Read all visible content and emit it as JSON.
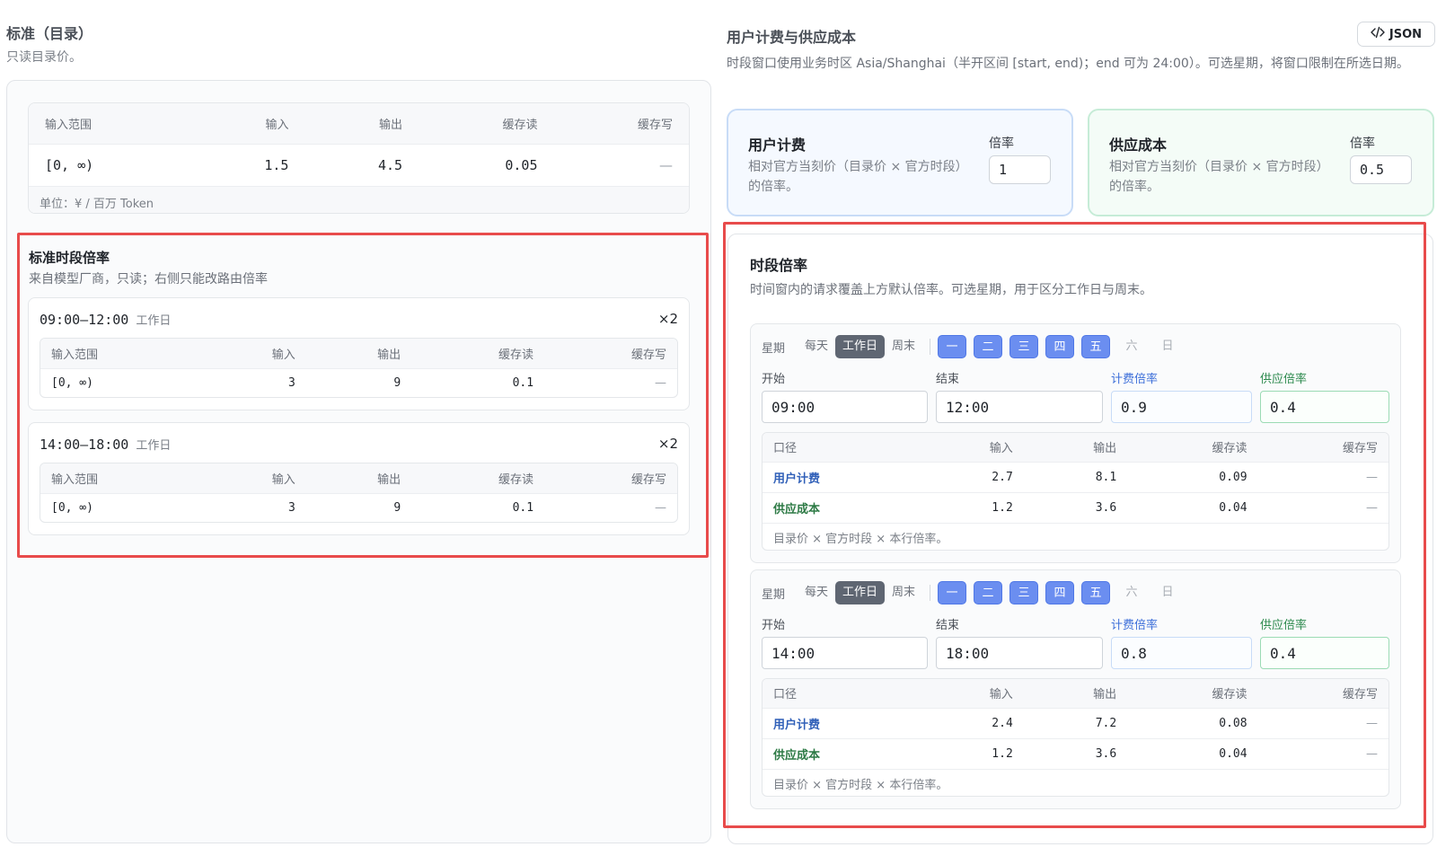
{
  "left": {
    "title": "标准（目录）",
    "subtitle": "只读目录价。",
    "base_table": {
      "headers": [
        "输入范围",
        "输入",
        "输出",
        "缓存读",
        "缓存写"
      ],
      "rows": [
        [
          "[0, ∞)",
          "1.5",
          "4.5",
          "0.05",
          "—"
        ]
      ],
      "unit": "单位：¥ / 百万 Token"
    },
    "std_period": {
      "title": "标准时段倍率",
      "subtitle": "来自模型厂商，只读；右侧只能改路由倍率",
      "slots": [
        {
          "time": "09:00–12:00",
          "tag": "工作日",
          "mult": "×2",
          "headers": [
            "输入范围",
            "输入",
            "输出",
            "缓存读",
            "缓存写"
          ],
          "row": [
            "[0, ∞)",
            "3",
            "9",
            "0.1",
            "—"
          ]
        },
        {
          "time": "14:00–18:00",
          "tag": "工作日",
          "mult": "×2",
          "headers": [
            "输入范围",
            "输入",
            "输出",
            "缓存读",
            "缓存写"
          ],
          "row": [
            "[0, ∞)",
            "3",
            "9",
            "0.1",
            "—"
          ]
        }
      ]
    }
  },
  "right": {
    "title": "用户计费与供应成本",
    "json_button": "JSON",
    "description": "时段窗口使用业务时区 Asia/Shanghai（半开区间 [start, end)；end 可为 24:00）。可选星期，将窗口限制在所选日期。",
    "user_card": {
      "title": "用户计费",
      "desc": "相对官方当刻价（目录价 × 官方时段）的倍率。",
      "rate_label": "倍率",
      "rate_value": "1"
    },
    "cost_card": {
      "title": "供应成本",
      "desc": "相对官方当刻价（目录价 × 官方时段）的倍率。",
      "rate_label": "倍率",
      "rate_value": "0.5"
    },
    "period": {
      "title": "时段倍率",
      "subtitle": "时间窗内的请求覆盖上方默认倍率。可选星期，用于区分工作日与周末。",
      "rules": [
        {
          "days_label": "星期",
          "presets": [
            "每天",
            "工作日",
            "周末"
          ],
          "active_preset": "工作日",
          "weekdays": [
            "一",
            "二",
            "三",
            "四",
            "五",
            "六",
            "日"
          ],
          "weekdays_on": [
            true,
            true,
            true,
            true,
            true,
            false,
            false
          ],
          "start_label": "开始",
          "start": "09:00",
          "end_label": "结束",
          "end": "12:00",
          "bill_label": "计费倍率",
          "bill": "0.9",
          "supply_label": "供应倍率",
          "supply": "0.4",
          "headers": [
            "口径",
            "输入",
            "输出",
            "缓存读",
            "缓存写"
          ],
          "rows": [
            [
              "用户计费",
              "2.7",
              "8.1",
              "0.09",
              "—"
            ],
            [
              "供应成本",
              "1.2",
              "3.6",
              "0.04",
              "—"
            ]
          ],
          "note": "目录价 × 官方时段 × 本行倍率。"
        },
        {
          "days_label": "星期",
          "presets": [
            "每天",
            "工作日",
            "周末"
          ],
          "active_preset": "工作日",
          "weekdays": [
            "一",
            "二",
            "三",
            "四",
            "五",
            "六",
            "日"
          ],
          "weekdays_on": [
            true,
            true,
            true,
            true,
            true,
            false,
            false
          ],
          "start_label": "开始",
          "start": "14:00",
          "end_label": "结束",
          "end": "18:00",
          "bill_label": "计费倍率",
          "bill": "0.8",
          "supply_label": "供应倍率",
          "supply": "0.4",
          "headers": [
            "口径",
            "输入",
            "输出",
            "缓存读",
            "缓存写"
          ],
          "rows": [
            [
              "用户计费",
              "2.4",
              "7.2",
              "0.08",
              "—"
            ],
            [
              "供应成本",
              "1.2",
              "3.6",
              "0.04",
              "—"
            ]
          ],
          "note": "目录价 × 官方时段 × 本行倍率。"
        }
      ]
    }
  }
}
